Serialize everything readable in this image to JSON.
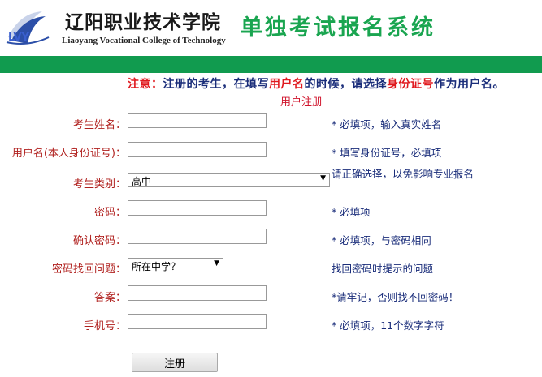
{
  "header": {
    "school_name_cn": "辽阳职业技术学院",
    "school_name_en": "Liaoyang Vocational College of Technology",
    "system_title": "单独考试报名系统"
  },
  "notice": {
    "prefix": "注意：",
    "part1": "注册的考生，在填写",
    "highlight1": "用户名",
    "part2": "的时候，请选择",
    "highlight2": "身份证号",
    "part3": "作为用户名。"
  },
  "form": {
    "title": "用户注册",
    "fields": {
      "name": {
        "label": "考生姓名：",
        "value": "",
        "hint": "*  必填项，输入真实姓名"
      },
      "username": {
        "label": "用户名(本人身份证号)：",
        "value": "",
        "hint": "*   填写身份证号，必填项"
      },
      "category": {
        "label": "考生类别：",
        "value": "高中",
        "hint": "请正确选择，以免影响专业报名"
      },
      "password": {
        "label": "密码：",
        "value": "",
        "hint": "*  必填项"
      },
      "confirm_password": {
        "label": "确认密码：",
        "value": "",
        "hint": "*   必填项，与密码相同"
      },
      "question": {
        "label": "密码找回问题：",
        "value": "所在中学？",
        "hint": "找回密码时提示的问题"
      },
      "answer": {
        "label": "答案：",
        "value": "",
        "hint": "*请牢记，否则找不回密码！"
      },
      "phone": {
        "label": "手机号：",
        "value": "",
        "hint": "*   必填项，11个数字字符"
      }
    },
    "submit_label": "注册"
  },
  "colors": {
    "brand_green": "#119b4f",
    "title_green": "#1aa550",
    "label_red": "#b0201e",
    "hint_navy": "#1a2d7a"
  }
}
